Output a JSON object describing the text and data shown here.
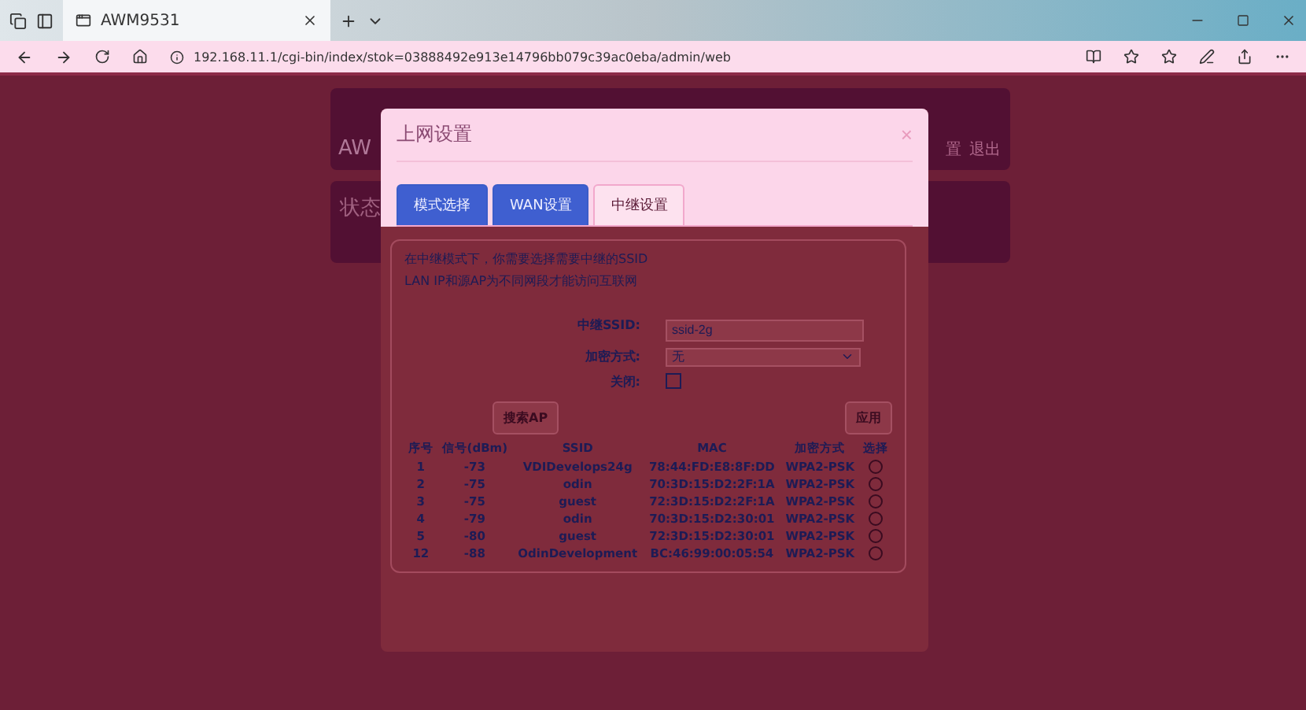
{
  "browser": {
    "tab_title": "AWM9531",
    "url": "192.168.11.1/cgi-bin/index/stok=03888492e913e14796bb079c39ac0eba/admin/web"
  },
  "page": {
    "brand": "AW",
    "links": [
      "置",
      "退出"
    ],
    "panel_title": "状态"
  },
  "dialog": {
    "title": "上网设置",
    "close": "×",
    "tabs": [
      {
        "label": "模式选择",
        "selected": false
      },
      {
        "label": "WAN设置",
        "selected": false
      },
      {
        "label": "中继设置",
        "selected": true
      }
    ],
    "notes": [
      "在中继模式下，你需要选择需要中继的SSID",
      "LAN IP和源AP为不同网段才能访问互联网"
    ],
    "fields": [
      {
        "kind": "text",
        "label": "中继SSID:",
        "value": "ssid-2g"
      },
      {
        "kind": "select",
        "label": "加密方式:",
        "value": "无"
      },
      {
        "kind": "checkbox",
        "label": "关闭:",
        "checked": false
      }
    ],
    "buttons": [
      "搜索AP",
      "应用"
    ],
    "table": {
      "columns": [
        "序号",
        "信号(dBm)",
        "SSID",
        "MAC",
        "加密方式",
        "选择"
      ],
      "rows": [
        {
          "cells": [
            "1",
            "-73",
            "VDIDevelops24g",
            "78:44:FD:E8:8F:DD",
            "WPA2-PSK"
          ],
          "selected": false
        },
        {
          "cells": [
            "2",
            "-75",
            "odin",
            "70:3D:15:D2:2F:1A",
            "WPA2-PSK"
          ],
          "selected": false
        },
        {
          "cells": [
            "3",
            "-75",
            "guest",
            "72:3D:15:D2:2F:1A",
            "WPA2-PSK"
          ],
          "selected": false
        },
        {
          "cells": [
            "4",
            "-79",
            "odin",
            "70:3D:15:D2:30:01",
            "WPA2-PSK"
          ],
          "selected": false
        },
        {
          "cells": [
            "5",
            "-80",
            "guest",
            "72:3D:15:D2:30:01",
            "WPA2-PSK"
          ],
          "selected": false
        },
        {
          "cells": [
            "12",
            "-88",
            "OdinDevelopment",
            "BC:46:99:00:05:54",
            "WPA2-PSK"
          ],
          "selected": false
        }
      ]
    }
  }
}
